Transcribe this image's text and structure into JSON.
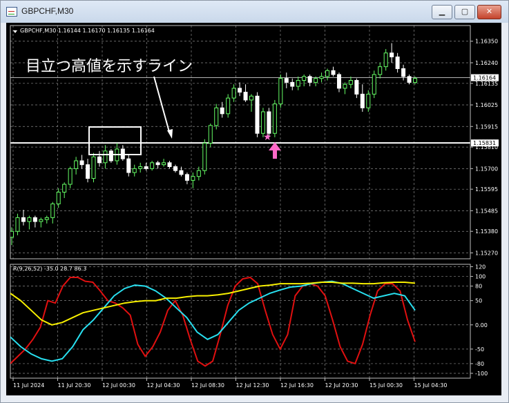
{
  "window": {
    "title": "GBPCHF,M30",
    "minimize_label": "▁",
    "maximize_label": "▢",
    "close_label": "✕"
  },
  "chart_data": [
    {
      "type": "candlestick",
      "symbol_info": "GBPCHF,M30  1.16144 1.16170 1.16135 1.16164",
      "ylim": [
        1.1524,
        1.1643
      ],
      "y_ticks": [
        "1.16350",
        "1.16240",
        "1.16135",
        "1.16025",
        "1.15915",
        "1.15810",
        "1.15700",
        "1.15595",
        "1.15485",
        "1.15380",
        "1.15270"
      ],
      "current_price": "1.16164",
      "horizontal_line": "1.15831",
      "annotation": "目立つ高値を示すライン",
      "bull_color": "#66ff66",
      "bear_color": "#ffffff",
      "candles": [
        [
          1.1535,
          1.154,
          1.1531,
          1.1538
        ],
        [
          1.1538,
          1.1547,
          1.1536,
          1.1545
        ],
        [
          1.1545,
          1.1549,
          1.1541,
          1.1543
        ],
        [
          1.1543,
          1.1546,
          1.1539,
          1.1545
        ],
        [
          1.1545,
          1.1546,
          1.154,
          1.1543
        ],
        [
          1.1543,
          1.1545,
          1.154,
          1.1544
        ],
        [
          1.1544,
          1.1546,
          1.1542,
          1.1545
        ],
        [
          1.1545,
          1.1553,
          1.1542,
          1.1552
        ],
        [
          1.1552,
          1.156,
          1.155,
          1.1558
        ],
        [
          1.1558,
          1.1563,
          1.1555,
          1.1562
        ],
        [
          1.1562,
          1.1571,
          1.156,
          1.157
        ],
        [
          1.157,
          1.1576,
          1.1567,
          1.1574
        ],
        [
          1.1574,
          1.1577,
          1.157,
          1.1572
        ],
        [
          1.1572,
          1.1575,
          1.1563,
          1.1565
        ],
        [
          1.1565,
          1.1578,
          1.1563,
          1.1576
        ],
        [
          1.1576,
          1.1579,
          1.1571,
          1.1573
        ],
        [
          1.1573,
          1.1582,
          1.157,
          1.1579
        ],
        [
          1.1579,
          1.158,
          1.1573,
          1.1574
        ],
        [
          1.1574,
          1.1583,
          1.1572,
          1.158
        ],
        [
          1.158,
          1.1582,
          1.1574,
          1.1575
        ],
        [
          1.1575,
          1.1577,
          1.1566,
          1.1568
        ],
        [
          1.1568,
          1.1572,
          1.1566,
          1.157
        ],
        [
          1.157,
          1.1573,
          1.1568,
          1.1571
        ],
        [
          1.1571,
          1.1573,
          1.1569,
          1.157
        ],
        [
          1.157,
          1.1574,
          1.1569,
          1.1573
        ],
        [
          1.1573,
          1.1574,
          1.157,
          1.1572
        ],
        [
          1.1572,
          1.1575,
          1.1571,
          1.1573
        ],
        [
          1.1573,
          1.1574,
          1.157,
          1.1571
        ],
        [
          1.1571,
          1.1572,
          1.1568,
          1.1569
        ],
        [
          1.1569,
          1.1571,
          1.1566,
          1.1567
        ],
        [
          1.1567,
          1.1568,
          1.1562,
          1.1564
        ],
        [
          1.1564,
          1.1568,
          1.156,
          1.1566
        ],
        [
          1.1566,
          1.1571,
          1.1564,
          1.1569
        ],
        [
          1.1569,
          1.1585,
          1.1567,
          1.1583
        ],
        [
          1.1583,
          1.1593,
          1.1581,
          1.1592
        ],
        [
          1.1592,
          1.1603,
          1.159,
          1.1601
        ],
        [
          1.1601,
          1.1604,
          1.1596,
          1.1598
        ],
        [
          1.1598,
          1.1608,
          1.1596,
          1.1606
        ],
        [
          1.1606,
          1.1613,
          1.1604,
          1.1611
        ],
        [
          1.1611,
          1.1614,
          1.1607,
          1.1609
        ],
        [
          1.1609,
          1.1613,
          1.1604,
          1.1605
        ],
        [
          1.1605,
          1.1608,
          1.1599,
          1.1607
        ],
        [
          1.1607,
          1.1609,
          1.1586,
          1.1588
        ],
        [
          1.1588,
          1.1601,
          1.1586,
          1.1599
        ],
        [
          1.1599,
          1.1601,
          1.1586,
          1.1588
        ],
        [
          1.1588,
          1.1605,
          1.1586,
          1.1603
        ],
        [
          1.1603,
          1.1618,
          1.1601,
          1.1616
        ],
        [
          1.1616,
          1.1619,
          1.1611,
          1.1614
        ],
        [
          1.1614,
          1.1616,
          1.161,
          1.1612
        ],
        [
          1.1612,
          1.1617,
          1.161,
          1.1615
        ],
        [
          1.1615,
          1.1618,
          1.1612,
          1.1617
        ],
        [
          1.1617,
          1.1618,
          1.1612,
          1.1614
        ],
        [
          1.1614,
          1.1617,
          1.1612,
          1.1616
        ],
        [
          1.1616,
          1.1619,
          1.1614,
          1.1617
        ],
        [
          1.1617,
          1.1621,
          1.1615,
          1.162
        ],
        [
          1.162,
          1.1622,
          1.1617,
          1.1618
        ],
        [
          1.1618,
          1.1619,
          1.1609,
          1.1611
        ],
        [
          1.1611,
          1.1614,
          1.1608,
          1.1613
        ],
        [
          1.1613,
          1.1617,
          1.1611,
          1.1615
        ],
        [
          1.1615,
          1.1616,
          1.1606,
          1.1608
        ],
        [
          1.1608,
          1.1613,
          1.1599,
          1.1601
        ],
        [
          1.1601,
          1.161,
          1.1599,
          1.1608
        ],
        [
          1.1608,
          1.162,
          1.1606,
          1.1618
        ],
        [
          1.1618,
          1.1624,
          1.1616,
          1.1622
        ],
        [
          1.1622,
          1.1631,
          1.162,
          1.1629
        ],
        [
          1.1629,
          1.1634,
          1.1624,
          1.1627
        ],
        [
          1.1627,
          1.1629,
          1.1619,
          1.1621
        ],
        [
          1.1621,
          1.1623,
          1.1615,
          1.1617
        ],
        [
          1.1617,
          1.1618,
          1.1613,
          1.1614
        ],
        [
          1.1614,
          1.1617,
          1.1613,
          1.1616
        ]
      ]
    },
    {
      "type": "line",
      "label": "R(9,26,52) -35.0 28.7 86.3",
      "ylim": [
        -110,
        125
      ],
      "y_ticks": [
        "120",
        "100",
        "80",
        "50",
        "0.00",
        "-50",
        "-80",
        "-100"
      ],
      "x_tick_labels": [
        "11 Jul 2024",
        "11 Jul 20:30",
        "12 Jul 00:30",
        "12 Jul 04:30",
        "12 Jul 08:30",
        "12 Jul 12:30",
        "12 Jul 16:30",
        "12 Jul 20:30",
        "15 Jul 00:30",
        "15 Jul 04:30"
      ],
      "series": [
        {
          "color": "#e01010",
          "values": [
            -80,
            -65,
            -50,
            -30,
            -5,
            50,
            45,
            80,
            98,
            98,
            90,
            88,
            70,
            50,
            45,
            35,
            20,
            -40,
            -65,
            -45,
            -15,
            30,
            50,
            20,
            -30,
            -75,
            -85,
            -75,
            -20,
            40,
            80,
            95,
            98,
            85,
            30,
            -20,
            -50,
            -20,
            60,
            80,
            85,
            80,
            60,
            10,
            -45,
            -75,
            -80,
            -40,
            20,
            70,
            85,
            85,
            70,
            10,
            -35
          ]
        },
        {
          "color": "#28e0f0",
          "values": [
            -25,
            -45,
            -60,
            -70,
            -75,
            -70,
            -45,
            -10,
            10,
            35,
            60,
            75,
            82,
            80,
            70,
            55,
            35,
            15,
            -15,
            -30,
            -20,
            5,
            30,
            45,
            55,
            65,
            72,
            78,
            80,
            85,
            88,
            90,
            85,
            75,
            65,
            55,
            60,
            65,
            60,
            30
          ]
        },
        {
          "color": "#f8f000",
          "values": [
            65,
            50,
            30,
            10,
            0,
            5,
            15,
            25,
            30,
            35,
            40,
            45,
            48,
            50,
            50,
            55,
            55,
            58,
            60,
            60,
            62,
            65,
            70,
            75,
            80,
            82,
            85,
            85,
            85,
            86,
            88,
            88,
            86,
            86,
            85,
            85,
            87,
            88,
            88,
            86
          ]
        }
      ]
    }
  ]
}
